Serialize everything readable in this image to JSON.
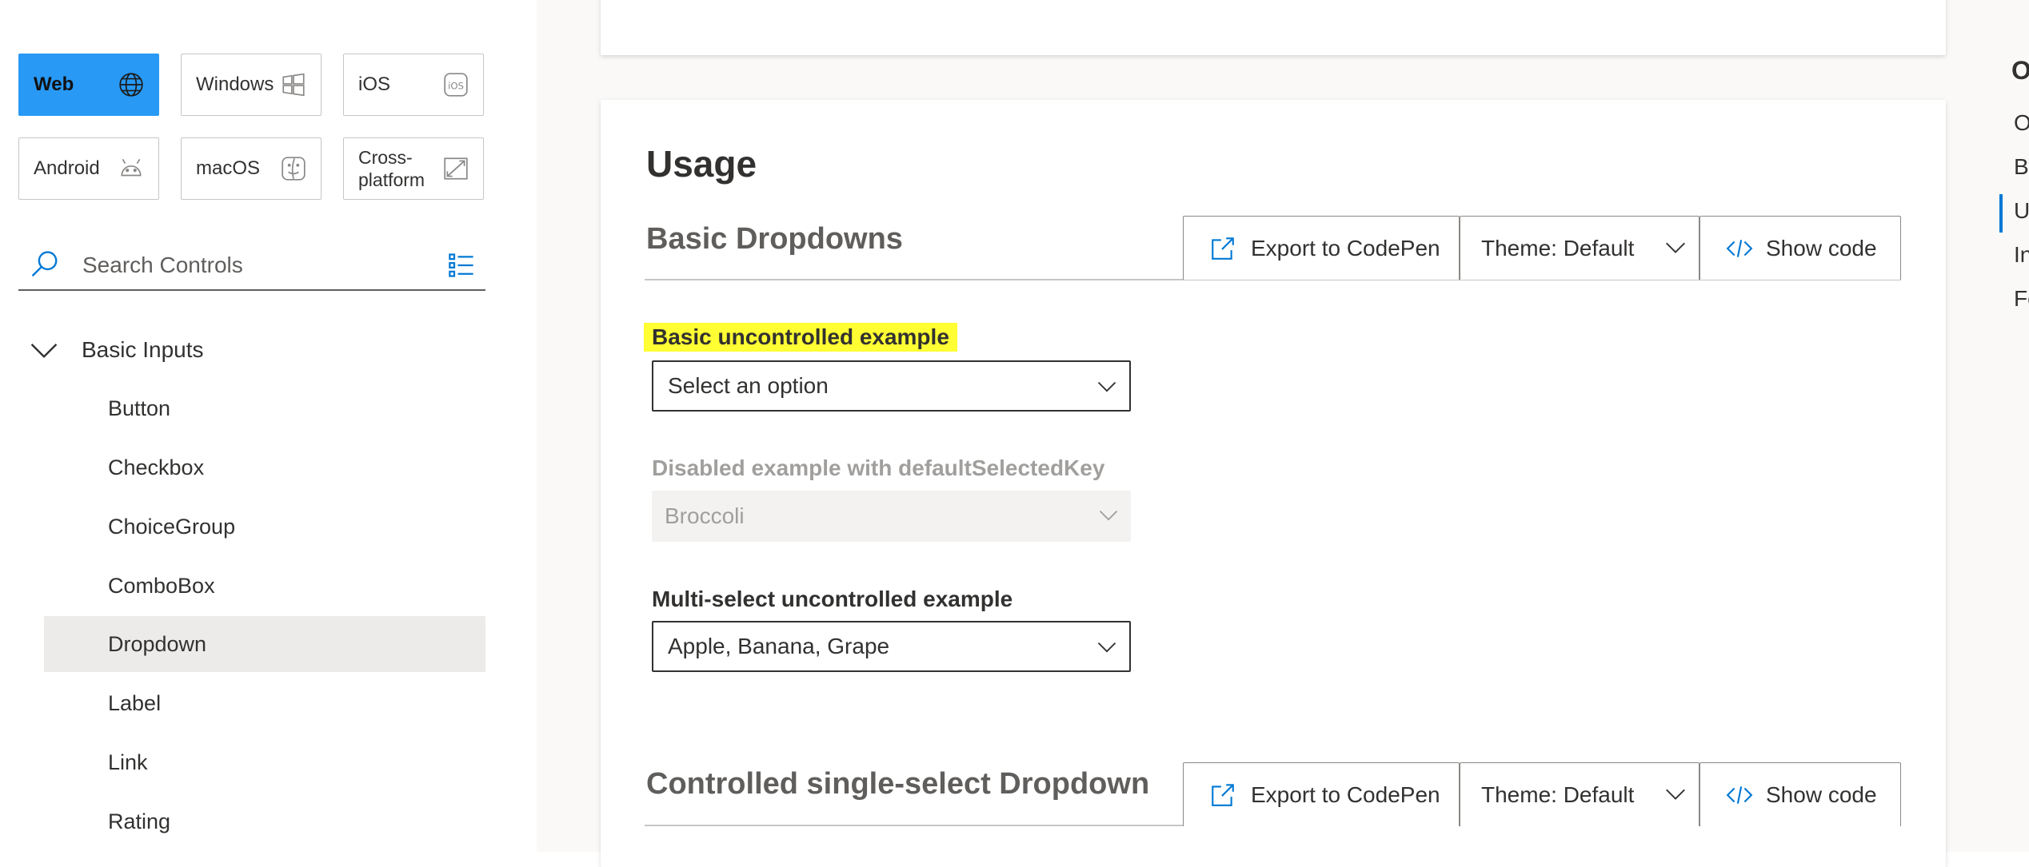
{
  "platforms": [
    {
      "label": "Web",
      "icon": "globe-icon",
      "active": true
    },
    {
      "label": "Windows",
      "icon": "windows-icon"
    },
    {
      "label": "iOS",
      "icon": "ios-icon"
    },
    {
      "label": "Android",
      "icon": "android-icon"
    },
    {
      "label": "macOS",
      "icon": "finder-icon"
    },
    {
      "label": "Cross-\nplatform",
      "icon": "cross-platform-icon"
    }
  ],
  "search": {
    "placeholder": "Search Controls"
  },
  "nav": {
    "group": "Basic Inputs",
    "items": [
      "Button",
      "Checkbox",
      "ChoiceGroup",
      "ComboBox",
      "Dropdown",
      "Label",
      "Link",
      "Rating"
    ],
    "selected": "Dropdown"
  },
  "main": {
    "heading": "Usage",
    "sections": [
      {
        "title": "Basic Dropdowns"
      },
      {
        "title": "Controlled single-select Dropdown"
      }
    ],
    "toolbar": {
      "export": "Export to CodePen",
      "theme": "Theme: Default",
      "code": "Show code"
    },
    "examples": [
      {
        "label": "Basic uncontrolled example",
        "value": "Select an option"
      },
      {
        "label": "Disabled example with defaultSelectedKey",
        "value": "Broccoli"
      },
      {
        "label": "Multi-select uncontrolled example",
        "value": "Apple, Banana, Grape"
      }
    ]
  },
  "toc": {
    "title": "O",
    "items": [
      "O",
      "Be",
      "U",
      "In",
      "Fe"
    ]
  },
  "colors": {
    "accent": "#2899f5",
    "highlight": "#ffff33",
    "toc_active": "#0078d4"
  }
}
